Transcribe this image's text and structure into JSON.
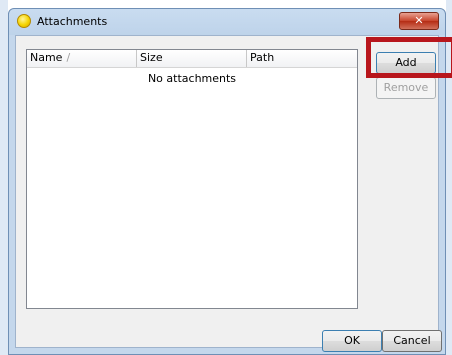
{
  "window": {
    "title": "Attachments",
    "close_label": "✕"
  },
  "list": {
    "columns": [
      "Name",
      "Size",
      "Path"
    ],
    "sort_indicator": "/",
    "empty_text": "No attachments"
  },
  "buttons": {
    "add": "Add",
    "remove": "Remove",
    "ok": "OK",
    "cancel": "Cancel"
  },
  "colors": {
    "highlight": "#b8161c",
    "titlebar": "#c9dcf0"
  }
}
